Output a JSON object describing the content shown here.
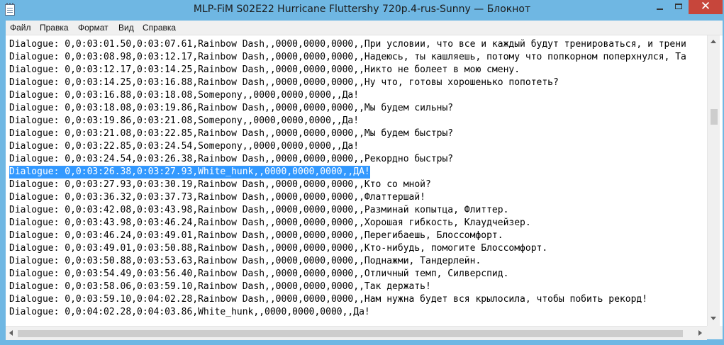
{
  "window": {
    "title": "MLP-FiM S02E22 Hurricane Fluttershy 720p.4-rus-Sunny — Блокнот",
    "close_glyph": "✕"
  },
  "menu": [
    "Файл",
    "Правка",
    "Формат",
    "Вид",
    "Справка"
  ],
  "lines": [
    "Dialogue: 0,0:03:01.50,0:03:07.61,Rainbow Dash,,0000,0000,0000,,При условии, что все и каждый будут тренироваться, и трени",
    "Dialogue: 0,0:03:08.98,0:03:12.17,Rainbow Dash,,0000,0000,0000,,Надеюсь, ты кашляешь, потому что попкорном поперхнулся, Та",
    "Dialogue: 0,0:03:12.17,0:03:14.25,Rainbow Dash,,0000,0000,0000,,Никто не болеет в мою смену.",
    "Dialogue: 0,0:03:14.25,0:03:16.88,Rainbow Dash,,0000,0000,0000,,Ну что, готовы хорошенько попотеть?",
    "Dialogue: 0,0:03:16.88,0:03:18.08,Somepony,,0000,0000,0000,,Да!",
    "Dialogue: 0,0:03:18.08,0:03:19.86,Rainbow Dash,,0000,0000,0000,,Мы будем сильны?",
    "Dialogue: 0,0:03:19.86,0:03:21.08,Somepony,,0000,0000,0000,,Да!",
    "Dialogue: 0,0:03:21.08,0:03:22.85,Rainbow Dash,,0000,0000,0000,,Мы будем быстры?",
    "Dialogue: 0,0:03:22.85,0:03:24.54,Somepony,,0000,0000,0000,,Да!",
    "Dialogue: 0,0:03:24.54,0:03:26.38,Rainbow Dash,,0000,0000,0000,,Рекордно быстры?",
    "Dialogue: 0,0:03:26.38,0:03:27.93,White_hunk,,0000,0000,0000,,ДА!",
    "Dialogue: 0,0:03:27.93,0:03:30.19,Rainbow Dash,,0000,0000,0000,,Кто со мной?",
    "Dialogue: 0,0:03:36.32,0:03:37.73,Rainbow Dash,,0000,0000,0000,,Флаттершай!",
    "Dialogue: 0,0:03:42.08,0:03:43.98,Rainbow Dash,,0000,0000,0000,,Разминай копытца, Флиттер.",
    "Dialogue: 0,0:03:43.98,0:03:46.24,Rainbow Dash,,0000,0000,0000,,Хорошая гибкость, Клаудчейзер.",
    "Dialogue: 0,0:03:46.24,0:03:49.01,Rainbow Dash,,0000,0000,0000,,Перегибаешь, Блоссомфорт.",
    "Dialogue: 0,0:03:49.01,0:03:50.88,Rainbow Dash,,0000,0000,0000,,Кто-нибудь, помогите Блоссомфорт.",
    "Dialogue: 0,0:03:50.88,0:03:53.63,Rainbow Dash,,0000,0000,0000,,Поднажми, Тандерлейн.",
    "Dialogue: 0,0:03:54.49,0:03:56.40,Rainbow Dash,,0000,0000,0000,,Отличный темп, Силверспид.",
    "Dialogue: 0,0:03:58.06,0:03:59.10,Rainbow Dash,,0000,0000,0000,,Так держать!",
    "Dialogue: 0,0:03:59.10,0:04:02.28,Rainbow Dash,,0000,0000,0000,,Нам нужна будет вся крылосила, чтобы побить рекорд!",
    "Dialogue: 0,0:04:02.28,0:04:03.86,White_hunk,,0000,0000,0000,,Да!"
  ],
  "selected_line": 10,
  "colors": {
    "frame": "#6fb7e3",
    "selection": "#3399ff",
    "close": "#c7463b"
  }
}
